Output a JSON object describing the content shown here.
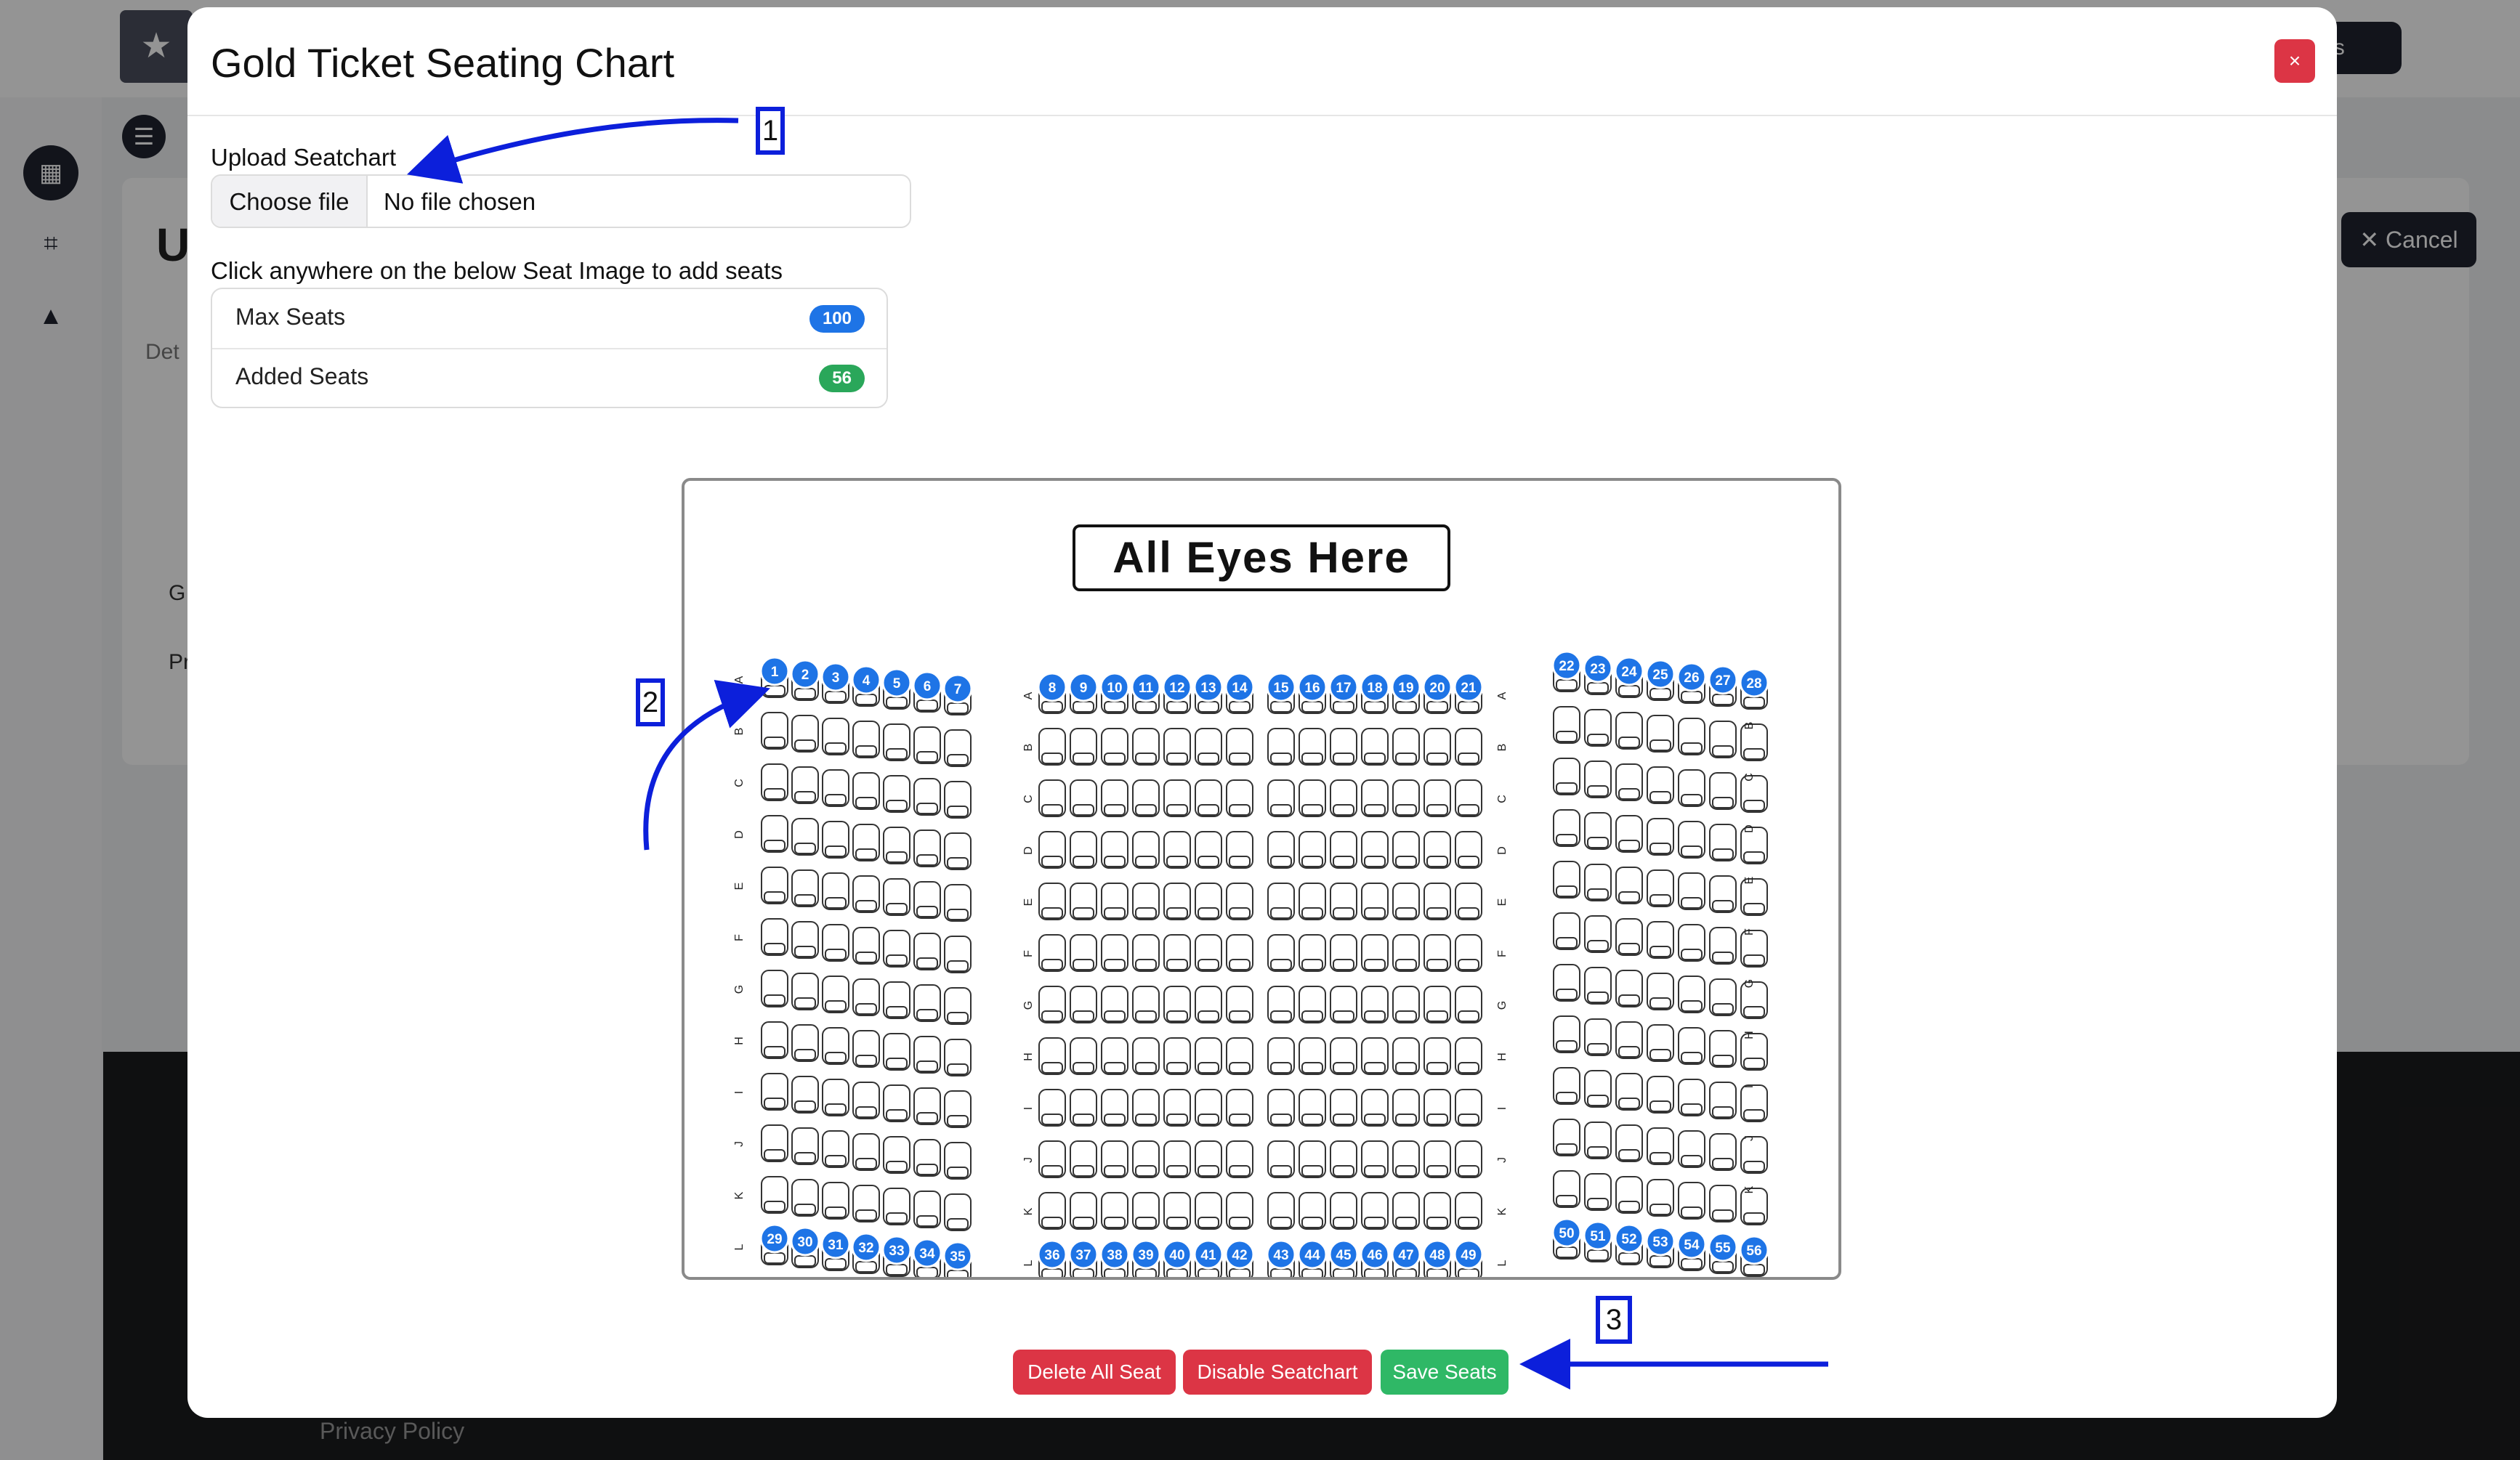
{
  "background": {
    "logo_glyph": "★",
    "top_button_label": "ents",
    "menu_glyph": "☰",
    "title_fragment": "U",
    "tab_fragment": "Det",
    "row_fragment_1": "G",
    "row_fragment_2": "Pr",
    "cancel_label": "✕ Cancel",
    "footer_link": "Privacy Policy",
    "sidebar_icons": [
      "calendar-icon",
      "qr-code-icon",
      "warning-icon"
    ]
  },
  "modal": {
    "title": "Gold Ticket Seating Chart",
    "close_label": "×",
    "upload_label": "Upload Seatchart",
    "file_button": "Choose file",
    "file_status": "No file chosen",
    "instruction": "Click anywhere on the below Seat Image to add seats",
    "stats": [
      {
        "label": "Max Seats",
        "value": "100"
      },
      {
        "label": "Added Seats",
        "value": "56"
      }
    ],
    "seat_map": {
      "stage_label": "All Eyes Here",
      "row_letters": [
        "A",
        "B",
        "C",
        "D",
        "E",
        "F",
        "G",
        "H",
        "I",
        "J",
        "K",
        "L"
      ],
      "added_seat_numbers": {
        "left_row_a": [
          "1",
          "2",
          "3",
          "4",
          "5",
          "6",
          "7"
        ],
        "center_row_a": [
          "8",
          "9",
          "10",
          "11",
          "12",
          "13",
          "14",
          "15",
          "16",
          "17",
          "18",
          "19",
          "20",
          "21"
        ],
        "right_row_a": [
          "22",
          "23",
          "24",
          "25",
          "26",
          "27",
          "28"
        ],
        "left_row_l": [
          "29",
          "30",
          "31",
          "32",
          "33",
          "34",
          "35"
        ],
        "center_row_l": [
          "36",
          "37",
          "38",
          "39",
          "40",
          "41",
          "42",
          "43",
          "44",
          "45",
          "46",
          "47",
          "48",
          "49"
        ],
        "right_row_l": [
          "50",
          "51",
          "52",
          "53",
          "54",
          "55",
          "56"
        ]
      }
    },
    "actions": {
      "delete": "Delete All Seat",
      "disable": "Disable Seatchart",
      "save": "Save Seats"
    }
  },
  "annotations": {
    "callout_1": "1",
    "callout_2": "2",
    "callout_3": "3",
    "color": "#0c1fdb"
  },
  "colors": {
    "danger": "#dc3545",
    "success": "#2fb866",
    "primary": "#1e74e6",
    "seat_marker": "#1e74e6"
  }
}
